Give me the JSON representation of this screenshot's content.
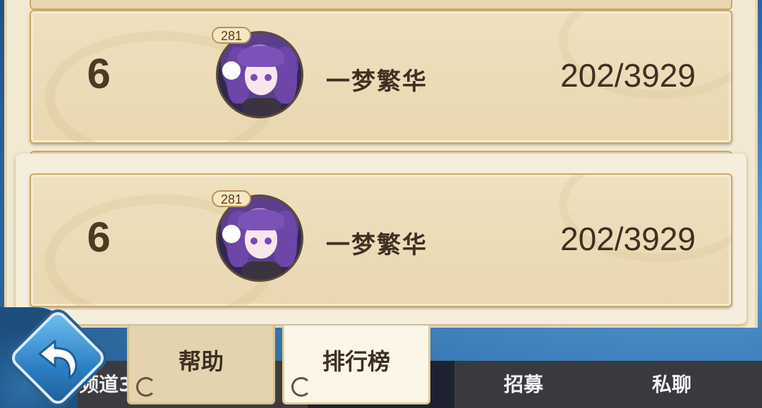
{
  "leaderboard": {
    "rows": [
      {
        "rank": "6",
        "level": "281",
        "name": "一梦繁华",
        "score": "202/3929"
      },
      {
        "rank": "6",
        "level": "281",
        "name": "一梦繁华",
        "score": "202/3929"
      }
    ]
  },
  "tabs": {
    "help": "帮助",
    "ranking": "排行榜"
  },
  "bottom_bar": {
    "channel": "频道3",
    "recruit": "招募",
    "private_chat": "私聊"
  },
  "icons": {
    "back": "back-arrow-icon"
  },
  "colors": {
    "panel": "#f3e9d3",
    "row": "#e9d7b1",
    "border_gold": "#c9a86a",
    "text_dark": "#3e3022",
    "back_button_blue": "#2d7fc4"
  }
}
